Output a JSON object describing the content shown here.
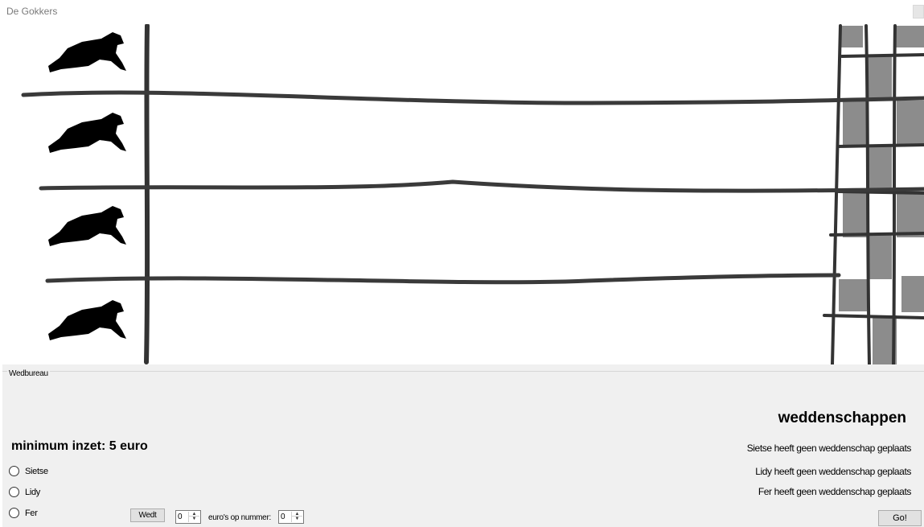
{
  "window": {
    "title": "De Gokkers"
  },
  "track": {
    "dogs": [
      "dog-1",
      "dog-2",
      "dog-3",
      "dog-4"
    ],
    "start_line_color": "#333333",
    "finish_square_color": "#8c8c8c"
  },
  "betting": {
    "group_label": "Wedbureau",
    "minimum_label": "minimum inzet: 5 euro",
    "players": [
      {
        "label": "Sietse",
        "selected": false
      },
      {
        "label": "Lidy",
        "selected": false
      },
      {
        "label": "Fer",
        "selected": false
      }
    ],
    "wedt_label": "Wedt",
    "amount_value": "0",
    "euros_label": "euro's op nummer:",
    "dog_number_value": "0",
    "bets_title": "weddenschappen",
    "bet_status": [
      "Sietse heeft geen weddenschap geplaats",
      "Lidy heeft geen weddenschap geplaats",
      "Fer heeft geen weddenschap geplaats"
    ],
    "go_label": "Go!"
  }
}
